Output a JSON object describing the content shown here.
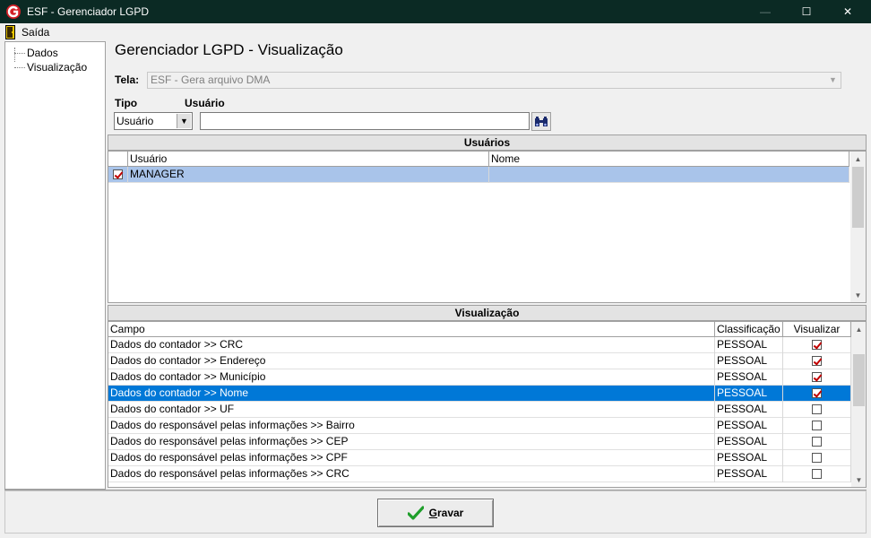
{
  "window": {
    "title": "ESF - Gerenciador LGPD",
    "minimize_glyph": "—",
    "maximize_glyph": "☐",
    "close_glyph": "✕"
  },
  "menu": {
    "exit_label": "Saída"
  },
  "tree": {
    "items": [
      {
        "label": "Dados"
      },
      {
        "label": "Visualização"
      }
    ]
  },
  "heading": "Gerenciador LGPD - Visualização",
  "form": {
    "tela_label": "Tela:",
    "tela_value": "ESF - Gera arquivo DMA",
    "tipo_label": "Tipo",
    "usuario_label": "Usuário",
    "tipo_value": "Usuário",
    "usuario_value": ""
  },
  "users_section": {
    "title": "Usuários",
    "columns": [
      "Usuário",
      "Nome"
    ],
    "rows": [
      {
        "checked": true,
        "usuario": "MANAGER",
        "nome": ""
      }
    ]
  },
  "view_section": {
    "title": "Visualização",
    "columns": [
      "Campo",
      "Classificação",
      "Visualizar"
    ],
    "rows": [
      {
        "campo": "Dados do contador >> CRC",
        "classificacao": "PESSOAL",
        "visualizar": true,
        "selected": false
      },
      {
        "campo": "Dados do contador >> Endereço",
        "classificacao": "PESSOAL",
        "visualizar": true,
        "selected": false
      },
      {
        "campo": "Dados do contador >> Município",
        "classificacao": "PESSOAL",
        "visualizar": true,
        "selected": false
      },
      {
        "campo": "Dados do contador >> Nome",
        "classificacao": "PESSOAL",
        "visualizar": true,
        "selected": true
      },
      {
        "campo": "Dados do contador >> UF",
        "classificacao": "PESSOAL",
        "visualizar": false,
        "selected": false
      },
      {
        "campo": "Dados do responsável pelas informações >> Bairro",
        "classificacao": "PESSOAL",
        "visualizar": false,
        "selected": false
      },
      {
        "campo": "Dados do responsável pelas informações >> CEP",
        "classificacao": "PESSOAL",
        "visualizar": false,
        "selected": false
      },
      {
        "campo": "Dados do responsável pelas informações >> CPF",
        "classificacao": "PESSOAL",
        "visualizar": false,
        "selected": false
      },
      {
        "campo": "Dados do responsável pelas informações >> CRC",
        "classificacao": "PESSOAL",
        "visualizar": false,
        "selected": false
      }
    ]
  },
  "footer": {
    "save_prefix": "G",
    "save_rest": "ravar"
  },
  "colors": {
    "titlebar": "#0b2a24",
    "selected_user_row": "#a9c4ea",
    "selected_view_row": "#0078d7",
    "check_mark": "#c00000",
    "save_icon": "#1e9e2a"
  },
  "icons": {
    "app": "app-logo-icon",
    "exit": "exit-door-icon",
    "find": "binoculars-icon",
    "save": "check-icon"
  }
}
